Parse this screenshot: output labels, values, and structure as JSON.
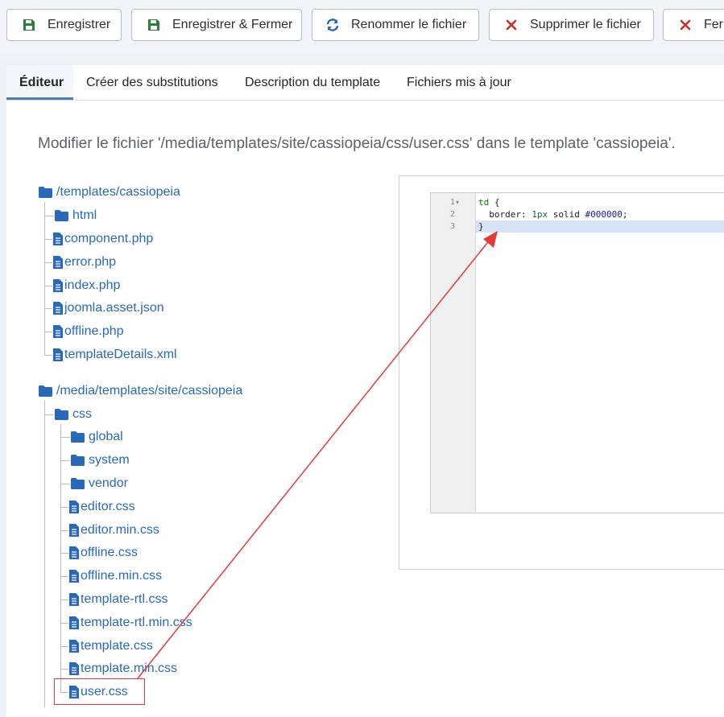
{
  "toolbar": {
    "save": "Enregistrer",
    "save_close": "Enregistrer & Fermer",
    "rename": "Renommer le fichier",
    "delete": "Supprimer le fichier",
    "close": "Fermer"
  },
  "tabs": {
    "editor": "Éditeur",
    "overrides": "Créer des substitutions",
    "template_desc": "Description du template",
    "updated": "Fichiers mis à jour"
  },
  "description": "Modifier le fichier '/media/templates/site/cassiopeia/css/user.css' dans le template 'cassiopeia'.",
  "tree": {
    "templates_root": "/templates/cassiopeia",
    "html": "html",
    "component": "component.php",
    "error": "error.php",
    "index": "index.php",
    "asset": "joomla.asset.json",
    "offline": "offline.php",
    "details": "templateDetails.xml",
    "media_root": "/media/templates/site/cassiopeia",
    "css": "css",
    "global": "global",
    "system": "system",
    "vendor": "vendor",
    "editor_css": "editor.css",
    "editor_min": "editor.min.css",
    "offline_css": "offline.css",
    "offline_min": "offline.min.css",
    "rtl": "template-rtl.css",
    "rtl_min": "template-rtl.min.css",
    "template_css": "template.css",
    "template_min": "template.min.css",
    "user_css": "user.css"
  },
  "code": {
    "line_numbers": [
      "1",
      "2",
      "3"
    ],
    "line1_sel": "td",
    "line1_brace": " {",
    "line2_prop": "  border: ",
    "line2_num": "1px",
    "line2_mid": " solid ",
    "line2_color": "#000000",
    "line2_end": ";",
    "line3": "}"
  },
  "colors": {
    "accent": "#2a69b8",
    "save_icon": "#2f7d3a",
    "delete_icon": "#c9302c",
    "annotation": "#e33a3a"
  }
}
